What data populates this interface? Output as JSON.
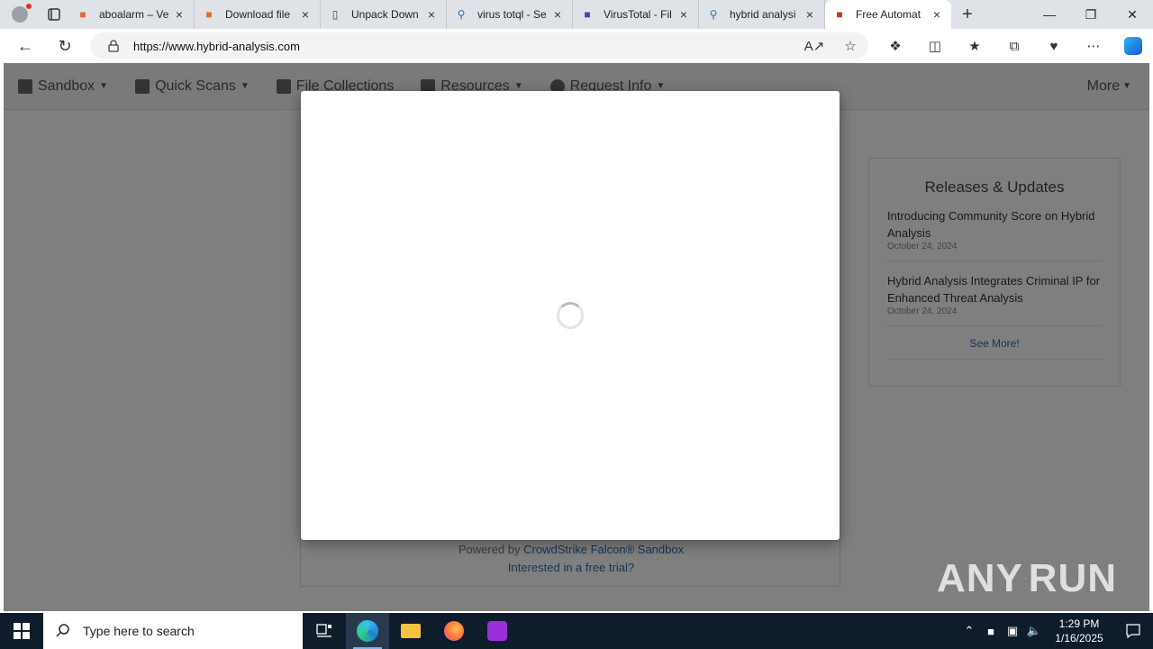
{
  "browser": {
    "tabs": [
      {
        "title": "aboalarm – Ve",
        "icon": "aboalarm-icon",
        "icon_color": "#e8682a"
      },
      {
        "title": "Download file",
        "icon": "download-icon",
        "icon_color": "#e8682a"
      },
      {
        "title": "Unpack Down",
        "icon": "page-icon",
        "icon_color": "#444"
      },
      {
        "title": "virus totql - Se",
        "icon": "search-icon",
        "icon_color": "#2a6fb0"
      },
      {
        "title": "VirusTotal - Fil",
        "icon": "virustotal-icon",
        "icon_color": "#3949ab"
      },
      {
        "title": "hybrid analysi",
        "icon": "search-icon",
        "icon_color": "#2a6fb0"
      },
      {
        "title": "Free Automat",
        "icon": "hybrid-analysis-icon",
        "icon_color": "#c0392b",
        "active": true
      }
    ],
    "url": "https://www.hybrid-analysis.com"
  },
  "site_nav": {
    "items": [
      {
        "label": "Sandbox"
      },
      {
        "label": "Quick Scans"
      },
      {
        "label": "File Collections"
      },
      {
        "label": "Resources"
      },
      {
        "label": "Request Info"
      }
    ],
    "more": "More"
  },
  "releases": {
    "title": "Releases & Updates",
    "items": [
      {
        "title": "Introducing Community Score on Hybrid Analysis",
        "date": "October 24, 2024"
      },
      {
        "title": "Hybrid Analysis Integrates Criminal IP for Enhanced Threat Analysis",
        "date": "October 24, 2024"
      }
    ],
    "see_more": "See More!"
  },
  "footer": {
    "powered_prefix": "Powered by ",
    "powered_link": "CrowdStrike Falcon® Sandbox",
    "trial": "Interested in a free trial?"
  },
  "watermark": "ANY RUN",
  "taskbar": {
    "search_placeholder": "Type here to search",
    "time": "1:29 PM",
    "date": "1/16/2025"
  }
}
